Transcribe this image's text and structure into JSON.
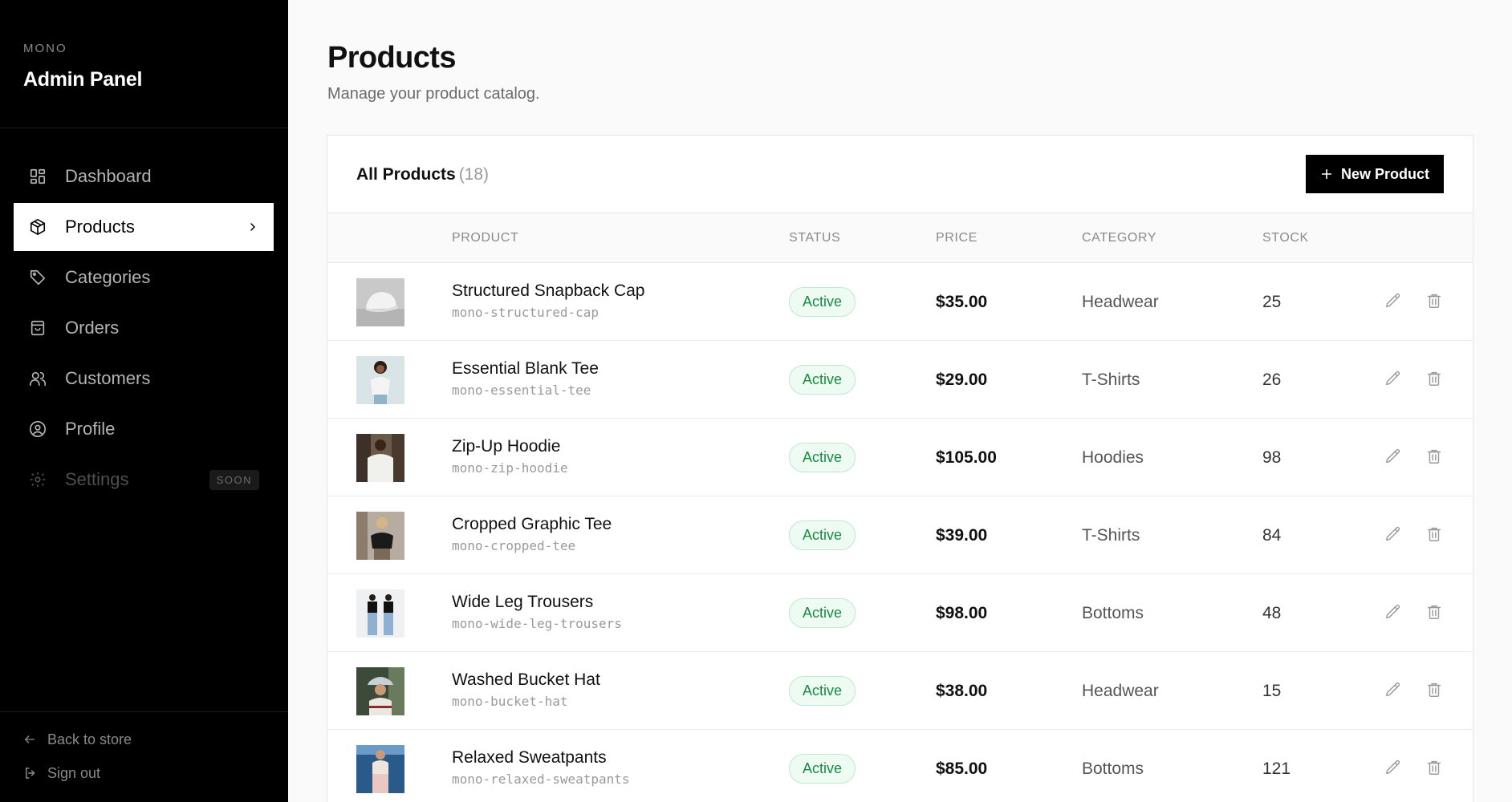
{
  "sidebar": {
    "brand_small": "MONO",
    "brand_title": "Admin Panel",
    "items": [
      {
        "label": "Dashboard",
        "icon": "dashboard-grid-icon"
      },
      {
        "label": "Products",
        "icon": "box-icon",
        "active": true
      },
      {
        "label": "Categories",
        "icon": "tag-icon"
      },
      {
        "label": "Orders",
        "icon": "shopping-bag-icon"
      },
      {
        "label": "Customers",
        "icon": "users-icon"
      },
      {
        "label": "Profile",
        "icon": "user-circle-icon"
      },
      {
        "label": "Settings",
        "icon": "gear-icon",
        "disabled": true,
        "badge": "SOON"
      }
    ],
    "back_to_store": "Back to store",
    "sign_out": "Sign out"
  },
  "header": {
    "title": "Products",
    "subtitle": "Manage your product catalog."
  },
  "card": {
    "title": "All Products",
    "count": "(18)",
    "new_button": "New Product"
  },
  "table": {
    "columns": [
      "PRODUCT",
      "STATUS",
      "PRICE",
      "CATEGORY",
      "STOCK"
    ],
    "rows": [
      {
        "name": "Structured Snapback Cap",
        "slug": "mono-structured-cap",
        "status": "Active",
        "price": "$35.00",
        "category": "Headwear",
        "stock": "25"
      },
      {
        "name": "Essential Blank Tee",
        "slug": "mono-essential-tee",
        "status": "Active",
        "price": "$29.00",
        "category": "T-Shirts",
        "stock": "26"
      },
      {
        "name": "Zip-Up Hoodie",
        "slug": "mono-zip-hoodie",
        "status": "Active",
        "price": "$105.00",
        "category": "Hoodies",
        "stock": "98"
      },
      {
        "name": "Cropped Graphic Tee",
        "slug": "mono-cropped-tee",
        "status": "Active",
        "price": "$39.00",
        "category": "T-Shirts",
        "stock": "84"
      },
      {
        "name": "Wide Leg Trousers",
        "slug": "mono-wide-leg-trousers",
        "status": "Active",
        "price": "$98.00",
        "category": "Bottoms",
        "stock": "48"
      },
      {
        "name": "Washed Bucket Hat",
        "slug": "mono-bucket-hat",
        "status": "Active",
        "price": "$38.00",
        "category": "Headwear",
        "stock": "15"
      },
      {
        "name": "Relaxed Sweatpants",
        "slug": "mono-relaxed-sweatpants",
        "status": "Active",
        "price": "$85.00",
        "category": "Bottoms",
        "stock": "121"
      }
    ]
  },
  "colors": {
    "sidebar_bg": "#000000",
    "accent": "#000000",
    "status_active_text": "#1a8a42",
    "status_active_bg": "#eefbf2"
  }
}
